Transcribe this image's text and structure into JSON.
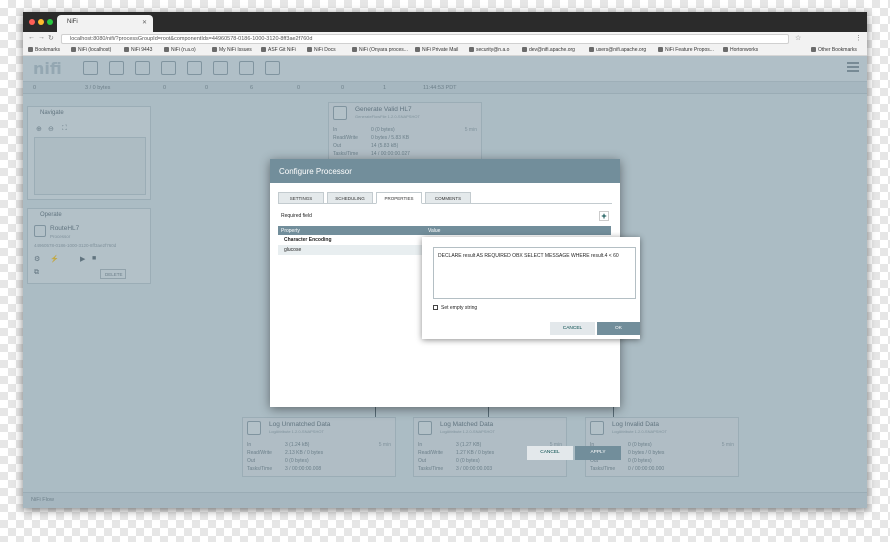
{
  "browser": {
    "tab_title": "NiFi",
    "url": "localhost:8080/nifi/?processGroupId=root&componentIds=44960578-0186-1000-3120-8ff3ae2f760d",
    "bookmarks": [
      "Bookmarks",
      "NiFi (localhost)",
      "NiFi 9443",
      "NiFi (n.a.o)",
      "My NiFi Issues",
      "ASF Git NiFi",
      "NiFi Docs",
      "NiFi (Onyara proces...",
      "NiFi Private Mail",
      "security@n.a.o",
      "dev@nifi.apache.org",
      "users@nifi.apache.org",
      "NiFi Feature Propos...",
      "Hortonworks"
    ],
    "other_bookmarks": "Other Bookmarks"
  },
  "app": {
    "logo": "nifi",
    "status": {
      "threads": "0",
      "queued": "3 / 0 bytes",
      "b1": "0",
      "b2": "0",
      "running": "6",
      "stopped": "0",
      "invalid": "0",
      "disabled": "1",
      "time": "11:44:53 PDT"
    },
    "footer": "NiFi Flow"
  },
  "navigate": {
    "title": "Navigate"
  },
  "operate": {
    "title": "Operate",
    "component_name": "RouteHL7",
    "component_type": "Processor",
    "component_id": "44960578-0186-1000-3120-8ff3ae2f760d",
    "delete_label": "DELETE"
  },
  "processors": [
    {
      "name": "Generate Valid HL7",
      "sub": "GenerateFlowFile 1.2.0-SNAPSHOT",
      "group": "org.apache.nifi - nifi-standard-nar",
      "in": "0 (0 bytes)",
      "rw": "0 bytes / 5.83 KB",
      "out": "14 (5.83 kB)",
      "tasks": "14 / 00:00:00.027",
      "window": "5 min"
    },
    {
      "name": "Log Unmatched Data",
      "sub": "LogAttribute 1.2.0-SNAPSHOT",
      "group": "org.apache.nifi - nifi-standard-nar",
      "in": "3 (1.24 kB)",
      "rw": "2.13 KB / 0 bytes",
      "out": "0 (0 bytes)",
      "tasks": "3 / 00:00:00.008",
      "window": "5 min"
    },
    {
      "name": "Log Matched Data",
      "sub": "LogAttribute 1.2.0-SNAPSHOT",
      "group": "org.apache.nifi - nifi-standard-nar",
      "in": "3 (1.27 KB)",
      "rw": "1.27 KB / 0 bytes",
      "out": "0 (0 bytes)",
      "tasks": "3 / 00:00:00.003",
      "window": "5 min"
    },
    {
      "name": "Log Invalid Data",
      "sub": "LogAttribute 1.2.0-SNAPSHOT",
      "group": "org.apache.nifi - nifi-standard-nar",
      "in": "0 (0 bytes)",
      "rw": "0 bytes / 0 bytes",
      "out": "0 (0 bytes)",
      "tasks": "0 / 00:00:00.000",
      "window": "5 min"
    }
  ],
  "proc_labels": {
    "in": "In",
    "rw": "Read/Write",
    "out": "Out",
    "tasks": "Tasks/Time"
  },
  "dialog": {
    "title": "Configure Processor",
    "tabs": [
      "SETTINGS",
      "SCHEDULING",
      "PROPERTIES",
      "COMMENTS"
    ],
    "required_field": "Required field",
    "col_property": "Property",
    "col_value": "Value",
    "properties": [
      "Character Encoding",
      "glucose"
    ],
    "cancel": "CANCEL",
    "apply": "APPLY"
  },
  "editor": {
    "value": "DECLARE result AS REQUIRED OBX SELECT MESSAGE WHERE result.4 < 60",
    "set_empty": "Set empty string",
    "cancel": "CANCEL",
    "ok": "OK"
  }
}
